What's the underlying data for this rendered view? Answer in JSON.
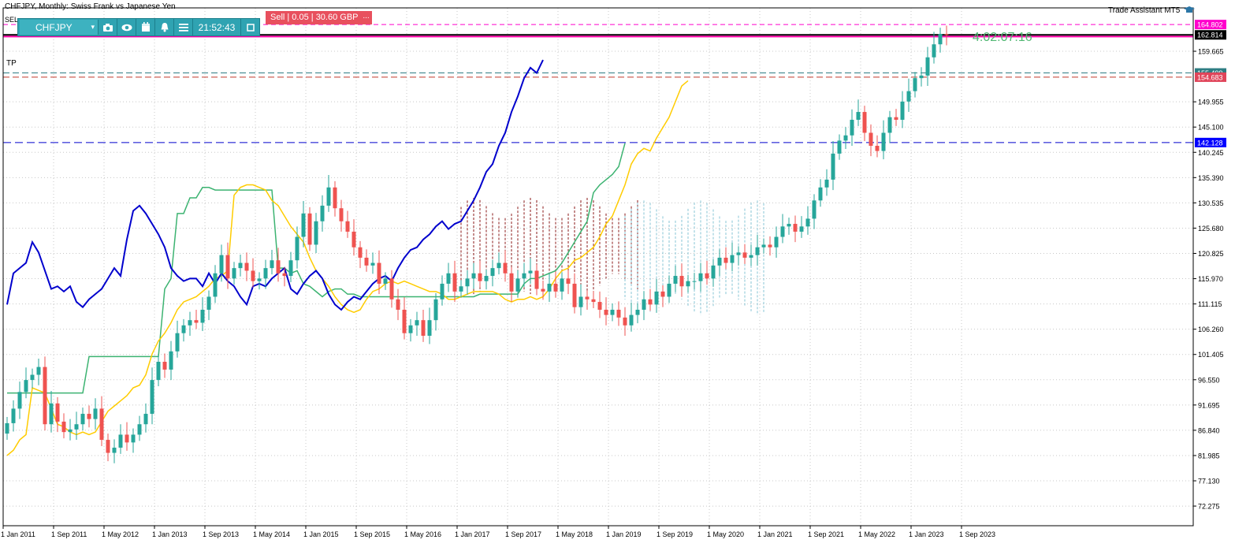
{
  "header": {
    "title": "CHFJPY, Monthly:  Swiss Frank vs Japanese Yen",
    "assistant": "Trade Assistant MT5",
    "timer": "4:02:07:16",
    "tp_label": "TP",
    "sell_label": "Sell | 0.05 | 30.60 GBP",
    "sell_extra": "...",
    "sel_label": "SEL"
  },
  "toolbar": {
    "symbol": "CHFJPY",
    "time": "21:52:43",
    "icons": [
      "camera-icon",
      "eye-icon",
      "calendar-icon",
      "bell-icon",
      "menu-icon",
      "window-icon"
    ]
  },
  "price_tags": [
    {
      "price": 164.802,
      "label": "164.802",
      "bg": "#ff00cc",
      "fg": "#ffffff"
    },
    {
      "price": 162.814,
      "label": "162.814",
      "bg": "#000000",
      "fg": "#ffffff"
    },
    {
      "price": 155.499,
      "label": "155.499",
      "bg": "#2e7d83",
      "fg": "#ffffff"
    },
    {
      "price": 154.683,
      "label": "154.683",
      "bg": "#e0455a",
      "fg": "#ffffff"
    },
    {
      "price": 142.128,
      "label": "142.128",
      "bg": "#0000ff",
      "fg": "#ffffff"
    }
  ],
  "colors": {
    "bull": "#26a69a",
    "bear": "#ef5350",
    "tenkan": "#ffcc00",
    "kijun": "#3cb371",
    "chikou": "#0000cd",
    "kumo_bear": "#8b1a1a",
    "kumo_bull": "#87c5d6",
    "grid": "#c8c8c8"
  },
  "chart_data": {
    "type": "candlestick",
    "title": "CHFJPY, Monthly:  Swiss Frank vs Japanese Yen",
    "xlabel": "",
    "ylabel": "",
    "ylim": [
      68.5,
      168.0
    ],
    "grid": true,
    "y_ticks": [
      "159.665",
      "149.955",
      "145.100",
      "140.245",
      "135.390",
      "130.535",
      "125.680",
      "120.825",
      "115.970",
      "111.115",
      "106.260",
      "101.405",
      "96.550",
      "91.695",
      "86.840",
      "81.985",
      "77.130",
      "72.275"
    ],
    "x_ticks": [
      {
        "label": "1 Jan 2011",
        "index": 0
      },
      {
        "label": "1 Sep 2011",
        "index": 8
      },
      {
        "label": "1 May 2012",
        "index": 16
      },
      {
        "label": "1 Jan 2013",
        "index": 24
      },
      {
        "label": "1 Sep 2013",
        "index": 32
      },
      {
        "label": "1 May 2014",
        "index": 40
      },
      {
        "label": "1 Jan 2015",
        "index": 48
      },
      {
        "label": "1 Sep 2015",
        "index": 56
      },
      {
        "label": "1 May 2016",
        "index": 64
      },
      {
        "label": "1 Jan 2017",
        "index": 72
      },
      {
        "label": "1 Sep 2017",
        "index": 80
      },
      {
        "label": "1 May 2018",
        "index": 88
      },
      {
        "label": "1 Jan 2019",
        "index": 96
      },
      {
        "label": "1 Sep 2019",
        "index": 104
      },
      {
        "label": "1 May 2020",
        "index": 112
      },
      {
        "label": "1 Jan 2021",
        "index": 120
      },
      {
        "label": "1 Sep 2021",
        "index": 128
      },
      {
        "label": "1 May 2022",
        "index": 136
      },
      {
        "label": "1 Jan 2023",
        "index": 144
      },
      {
        "label": "1 Sep 2023",
        "index": 152
      }
    ],
    "close_series": [
      88.2,
      91.0,
      94.2,
      96.5,
      97.5,
      99.0,
      88.0,
      92.0,
      88.5,
      86.5,
      87.0,
      88.0,
      90.0,
      89.0,
      91.0,
      85.0,
      82.5,
      83.5,
      86.0,
      84.5,
      86.0,
      88.0,
      90.0,
      96.5,
      100.0,
      98.5,
      102.0,
      105.5,
      107.0,
      108.0,
      107.5,
      110.0,
      112.5,
      117.0,
      120.5,
      116.0,
      118.0,
      119.0,
      117.5,
      115.5,
      116.0,
      118.0,
      119.5,
      117.0,
      116.5,
      119.5,
      124.0,
      128.5,
      122.5,
      127.0,
      130.0,
      133.5,
      129.5,
      127.0,
      125.0,
      122.0,
      120.0,
      118.5,
      119.0,
      115.0,
      116.0,
      112.0,
      110.0,
      105.5,
      107.0,
      108.0,
      105.0,
      108.0,
      112.0,
      115.0,
      117.0,
      113.5,
      114.5,
      116.0,
      117.0,
      115.5,
      116.5,
      118.0,
      119.0,
      117.0,
      113.5,
      116.0,
      117.0,
      117.5,
      114.0,
      113.5,
      115.0,
      113.5,
      116.0,
      115.0,
      110.5,
      112.5,
      112.0,
      111.5,
      110.0,
      109.0,
      110.0,
      108.5,
      107.0,
      109.0,
      110.0,
      112.0,
      111.0,
      113.5,
      112.5,
      115.0,
      116.5,
      114.5,
      115.5,
      115.5,
      117.0,
      116.0,
      118.5,
      120.0,
      119.0,
      120.5,
      121.0,
      120.0,
      120.5,
      122.0,
      122.5,
      122.0,
      124.0,
      126.0,
      126.5,
      125.0,
      126.0,
      127.5,
      131.0,
      133.5,
      135.0,
      140.0,
      142.5,
      143.5,
      146.5,
      148.0,
      144.0,
      141.5,
      140.5,
      144.0,
      147.0,
      146.5,
      150.0,
      152.0,
      154.5,
      155.0,
      158.5,
      161.0,
      163.0,
      162.814
    ],
    "ichimoku": {
      "tenkan": [
        82.0,
        83.0,
        85.0,
        86.0,
        95.0,
        94.5,
        94.0,
        91.0,
        88.0,
        87.5,
        86.5,
        86.0,
        86.5,
        86.0,
        86.5,
        88.5,
        90.5,
        91.5,
        92.5,
        93.5,
        95.0,
        95.5,
        97.5,
        101.5,
        104.0,
        105.5,
        107.5,
        110.0,
        111.5,
        112.0,
        112.5,
        113.5,
        114.5,
        116.0,
        116.5,
        117.5,
        132.0,
        133.5,
        134.0,
        134.0,
        133.5,
        133.0,
        131.0,
        130.0,
        128.0,
        126.0,
        124.5,
        123.0,
        120.0,
        117.5,
        116.0,
        114.5,
        112.5,
        111.0,
        110.0,
        109.5,
        110.0,
        112.0,
        113.5,
        114.0,
        115.0,
        115.5,
        115.0,
        115.5,
        115.0,
        114.5,
        114.0,
        113.5,
        113.5,
        113.0,
        112.0,
        112.0,
        112.5,
        113.0,
        113.5,
        113.5,
        113.5,
        113.5,
        113.0,
        112.0,
        111.5,
        112.0,
        112.0,
        112.5,
        112.0,
        112.5,
        114.0,
        116.0,
        117.5,
        118.0,
        119.5,
        120.0,
        121.0,
        122.0,
        124.0,
        126.5,
        128.0,
        131.0,
        134.0,
        138.0,
        140.0,
        141.0,
        140.5,
        143.0,
        145.0,
        147.0,
        150.0,
        153.0,
        154.0
      ],
      "kijun_values": [
        94.0,
        94.0,
        94.0,
        94.0,
        94.0,
        94.0,
        94.0,
        94.0,
        94.0,
        94.0,
        94.0,
        94.0,
        94.0,
        101.0,
        101.0,
        101.0,
        101.0,
        101.0,
        101.0,
        101.0,
        101.0,
        101.0,
        101.0,
        101.0,
        101.0,
        114.0,
        116.0,
        128.5,
        128.5,
        131.5,
        131.5,
        133.5,
        133.5,
        133.0,
        133.0,
        133.0,
        133.0,
        133.0,
        133.0,
        133.0,
        133.0,
        133.0,
        133.0,
        118.0,
        118.0,
        117.0,
        117.5,
        115.0,
        114.5,
        113.5,
        112.5,
        113.5,
        114.0,
        114.0,
        113.0,
        113.0,
        112.5,
        112.5,
        112.5,
        112.5,
        112.5,
        112.5,
        112.5,
        112.5,
        112.5,
        112.5,
        112.5,
        112.5,
        112.5,
        112.5,
        112.5,
        112.5,
        112.5,
        112.5,
        112.5,
        113.0,
        113.0,
        113.0,
        113.0,
        113.0,
        113.0,
        113.0,
        115.0,
        116.0,
        116.0,
        116.5,
        117.0,
        117.5,
        119.0,
        121.0,
        123.0,
        125.0,
        127.0,
        132.5,
        134.0,
        135.0,
        136.0,
        137.5,
        142.0
      ],
      "chikou_values": [
        111.0,
        117.0,
        118.0,
        119.0,
        123.0,
        121.0,
        117.5,
        114.0,
        114.5,
        113.5,
        114.5,
        111.5,
        110.5,
        112.0,
        113.0,
        114.0,
        116.0,
        118.0,
        116.5,
        123.5,
        129.0,
        130.0,
        128.5,
        126.5,
        124.5,
        122.0,
        118.0,
        116.5,
        115.5,
        116.0,
        116.0,
        114.5,
        117.0,
        115.0,
        117.0,
        115.5,
        114.5,
        112.5,
        111.0,
        114.5,
        115.0,
        114.5,
        116.0,
        117.0,
        118.0,
        114.0,
        113.0,
        115.0,
        116.5,
        117.5,
        116.0,
        113.0,
        111.0,
        110.0,
        111.5,
        112.5,
        112.0,
        113.5,
        115.0,
        116.0,
        116.5,
        115.5,
        118.0,
        120.0,
        121.5,
        122.0,
        123.5,
        124.5,
        126.0,
        127.0,
        125.5,
        126.5,
        127.0,
        129.0,
        131.0,
        133.5,
        136.5,
        138.0,
        141.5,
        144.0,
        148.0,
        151.0,
        154.5,
        156.5,
        155.5,
        158.0
      ],
      "kumo_bear_region": {
        "start": 72,
        "end": 100,
        "top": 129.5,
        "bottom": 115.0
      },
      "kumo_bull_region": {
        "start": 98,
        "end": 120,
        "top": 129.0,
        "bottom": 111.0
      }
    }
  }
}
